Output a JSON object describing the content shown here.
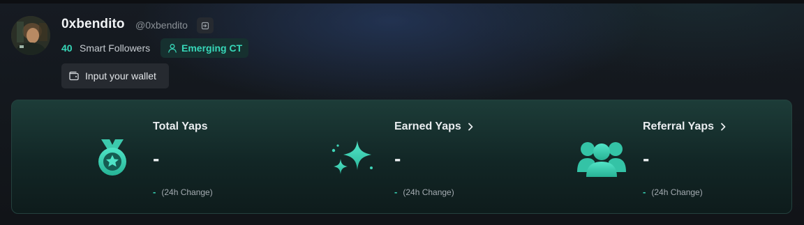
{
  "profile": {
    "display_name": "0xbendito",
    "handle": "@0xbendito",
    "smart_followers_count": "40",
    "smart_followers_label": "Smart Followers",
    "tier_badge": "Emerging CT",
    "wallet_button": "Input your wallet",
    "icons": {
      "handle_action": "sign-in-icon",
      "tier": "user-icon",
      "wallet": "wallet-icon"
    }
  },
  "stats": [
    {
      "title": "Total Yaps",
      "value": "-",
      "change_value": "-",
      "change_label": "(24h Change)",
      "has_chevron": false,
      "icon": "medal-star-icon"
    },
    {
      "title": "Earned Yaps",
      "value": "-",
      "change_value": "-",
      "change_label": "(24h Change)",
      "has_chevron": true,
      "icon": "sparkles-icon"
    },
    {
      "title": "Referral Yaps",
      "value": "-",
      "change_value": "-",
      "change_label": "(24h Change)",
      "has_chevron": true,
      "icon": "users-group-icon"
    }
  ],
  "colors": {
    "accent": "#37d8b9",
    "badge_bg": "#16302f",
    "button_bg": "#262a30",
    "card_border": "#24413e"
  }
}
